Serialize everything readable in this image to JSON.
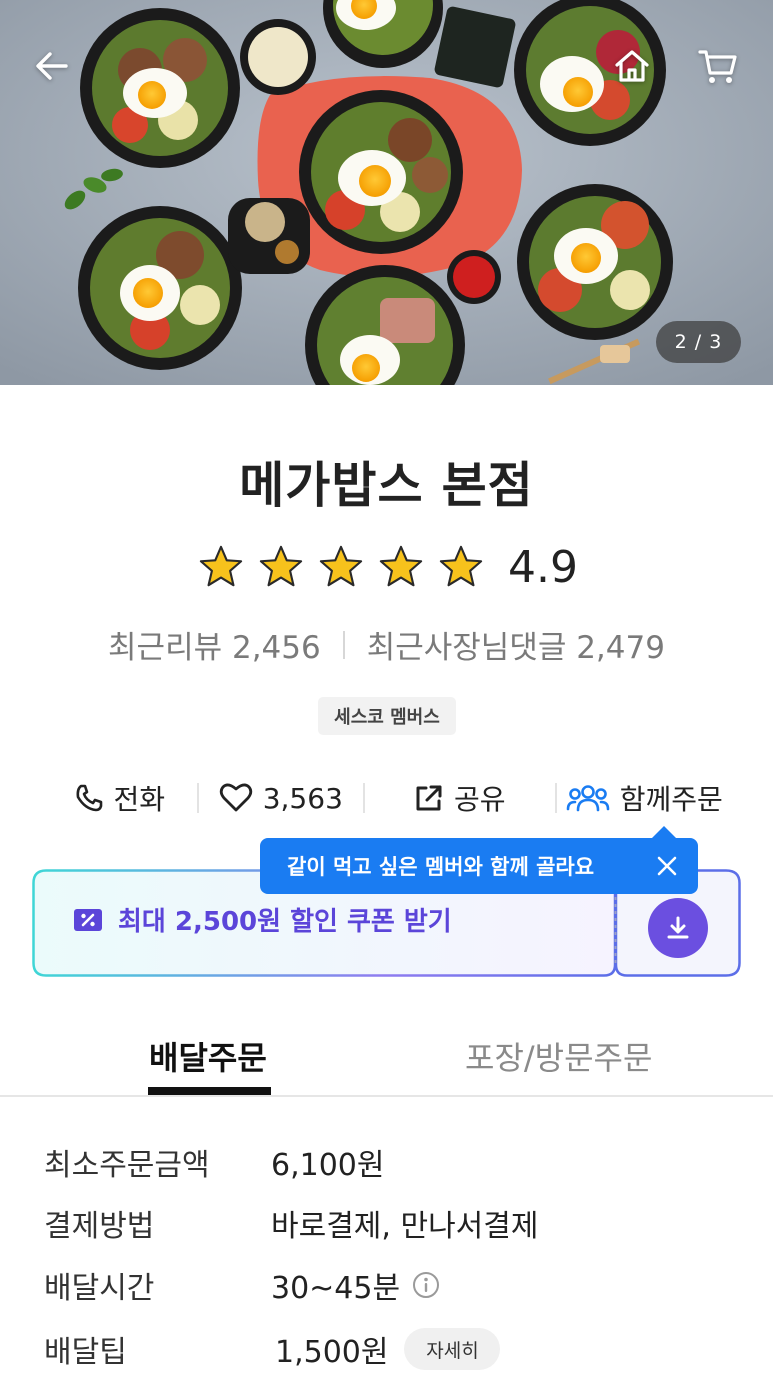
{
  "hero": {
    "back_icon": "arrow-left-icon",
    "home_icon": "home-icon",
    "cart_icon": "cart-icon",
    "page_indicator": "2 / 3"
  },
  "store": {
    "name": "메가밥스 본점",
    "rating": "4.9",
    "rating_value": 4.9,
    "rating_max": 5,
    "recent_reviews_label": "최근리뷰 2,456",
    "owner_replies_label": "최근사장님댓글 2,479",
    "badge": "세스코 멤버스"
  },
  "actions": {
    "call": {
      "label": "전화",
      "icon": "phone-icon"
    },
    "like": {
      "label": "3,563",
      "icon": "heart-icon"
    },
    "share": {
      "label": "공유",
      "icon": "share-icon"
    },
    "group": {
      "label": "함께주문",
      "icon": "group-icon"
    }
  },
  "tooltip": {
    "text": "같이 먹고 싶은 멤버와 함께 골라요",
    "close_icon": "close-icon"
  },
  "coupon": {
    "label": "최대 2,500원 할인 쿠폰 받기",
    "icon": "coupon-icon",
    "download_icon": "download-icon"
  },
  "tabs": {
    "delivery": "배달주문",
    "pickup": "포장/방문주문",
    "active": "delivery"
  },
  "info": {
    "min_order": {
      "label": "최소주문금액",
      "value": "6,100원"
    },
    "payment": {
      "label": "결제방법",
      "value": "바로결제, 만나서결제"
    },
    "delivery_time": {
      "label": "배달시간",
      "value": "30~45분",
      "icon": "info-icon"
    },
    "delivery_tip": {
      "label": "배달팁",
      "value": "1,500원",
      "detail_button": "자세히"
    }
  },
  "colors": {
    "accent_blue": "#1a7cf2",
    "coupon_purple": "#5b45d9",
    "star": "#f7c21c",
    "tab_active": "#111111"
  }
}
